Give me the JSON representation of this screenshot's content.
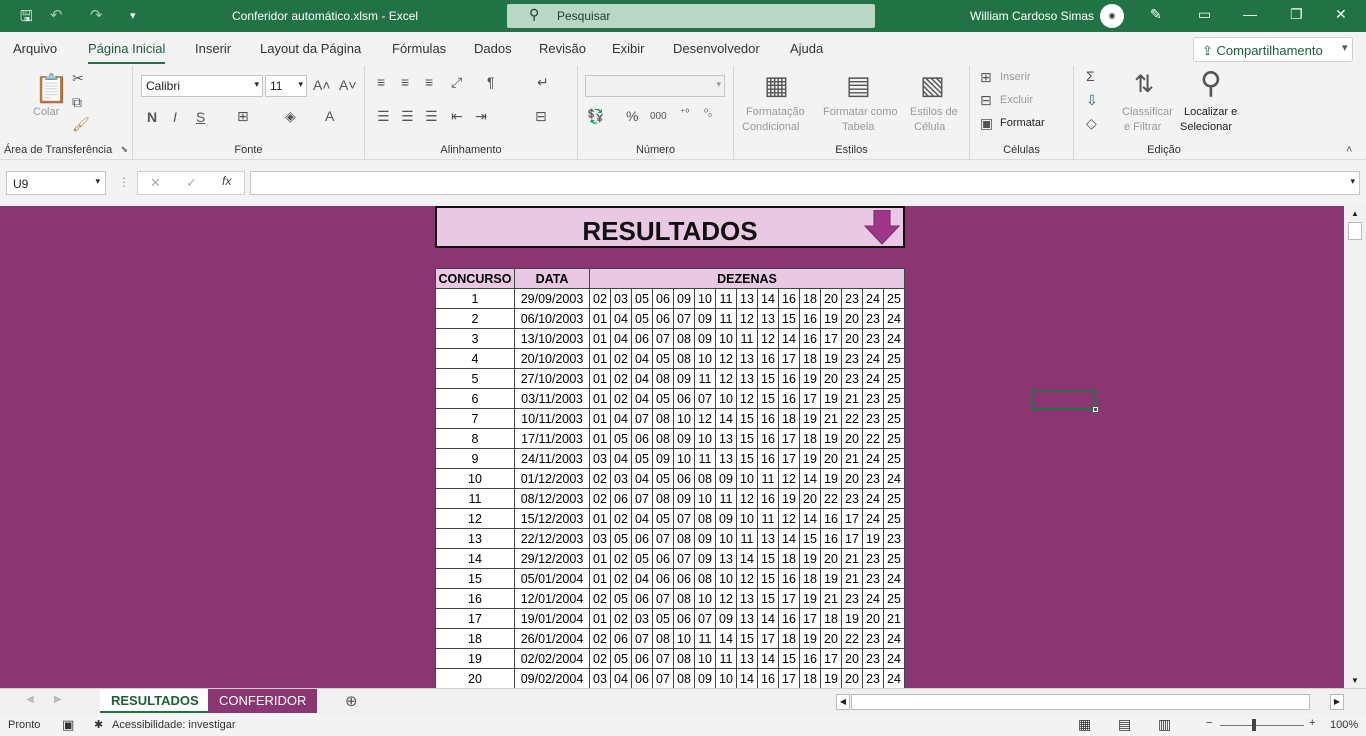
{
  "titlebar": {
    "file_title": "Conferidor automático.xlsm",
    "app_name": "Excel",
    "search_placeholder": "Pesquisar",
    "user_name": "William Cardoso Simas"
  },
  "menu": {
    "tabs": [
      "Arquivo",
      "Página Inicial",
      "Inserir",
      "Layout da Página",
      "Fórmulas",
      "Dados",
      "Revisão",
      "Exibir",
      "Desenvolvedor",
      "Ajuda"
    ],
    "active_tab": "Página Inicial",
    "share_label": "Compartilhamento"
  },
  "ribbon": {
    "clipboard": {
      "paste_label": "Colar",
      "group_label": "Área de Transferência"
    },
    "font": {
      "font_name": "Calibri",
      "font_size": "11",
      "bold": "N",
      "italic": "I",
      "underline": "S",
      "group_label": "Fonte"
    },
    "alignment": {
      "group_label": "Alinhamento"
    },
    "number": {
      "group_label": "Número"
    },
    "styles": {
      "cond_format_1": "Formatação",
      "cond_format_2": "Condicional",
      "format_table_1": "Formatar como",
      "format_table_2": "Tabela",
      "cell_styles_1": "Estilos de",
      "cell_styles_2": "Célula",
      "group_label": "Estilos"
    },
    "cells": {
      "insert": "Inserir",
      "delete": "Excluir",
      "format": "Formatar",
      "group_label": "Células"
    },
    "editing": {
      "sort_1": "Classificar",
      "sort_2": "e Filtrar",
      "find_1": "Localizar e",
      "find_2": "Selecionar",
      "group_label": "Edição"
    }
  },
  "formula_bar": {
    "name_box": "U9",
    "fx": "fx",
    "formula": ""
  },
  "sheet": {
    "banner_title": "RESULTADOS",
    "headers": {
      "concurso": "CONCURSO",
      "data": "DATA",
      "dezenas": "DEZENAS"
    },
    "rows": [
      {
        "concurso": "1",
        "data": "29/09/2003",
        "dezenas": [
          "02",
          "03",
          "05",
          "06",
          "09",
          "10",
          "11",
          "13",
          "14",
          "16",
          "18",
          "20",
          "23",
          "24",
          "25"
        ]
      },
      {
        "concurso": "2",
        "data": "06/10/2003",
        "dezenas": [
          "01",
          "04",
          "05",
          "06",
          "07",
          "09",
          "11",
          "12",
          "13",
          "15",
          "16",
          "19",
          "20",
          "23",
          "24"
        ]
      },
      {
        "concurso": "3",
        "data": "13/10/2003",
        "dezenas": [
          "01",
          "04",
          "06",
          "07",
          "08",
          "09",
          "10",
          "11",
          "12",
          "14",
          "16",
          "17",
          "20",
          "23",
          "24"
        ]
      },
      {
        "concurso": "4",
        "data": "20/10/2003",
        "dezenas": [
          "01",
          "02",
          "04",
          "05",
          "08",
          "10",
          "12",
          "13",
          "16",
          "17",
          "18",
          "19",
          "23",
          "24",
          "25"
        ]
      },
      {
        "concurso": "5",
        "data": "27/10/2003",
        "dezenas": [
          "01",
          "02",
          "04",
          "08",
          "09",
          "11",
          "12",
          "13",
          "15",
          "16",
          "19",
          "20",
          "23",
          "24",
          "25"
        ]
      },
      {
        "concurso": "6",
        "data": "03/11/2003",
        "dezenas": [
          "01",
          "02",
          "04",
          "05",
          "06",
          "07",
          "10",
          "12",
          "15",
          "16",
          "17",
          "19",
          "21",
          "23",
          "25"
        ]
      },
      {
        "concurso": "7",
        "data": "10/11/2003",
        "dezenas": [
          "01",
          "04",
          "07",
          "08",
          "10",
          "12",
          "14",
          "15",
          "16",
          "18",
          "19",
          "21",
          "22",
          "23",
          "25"
        ]
      },
      {
        "concurso": "8",
        "data": "17/11/2003",
        "dezenas": [
          "01",
          "05",
          "06",
          "08",
          "09",
          "10",
          "13",
          "15",
          "16",
          "17",
          "18",
          "19",
          "20",
          "22",
          "25"
        ]
      },
      {
        "concurso": "9",
        "data": "24/11/2003",
        "dezenas": [
          "03",
          "04",
          "05",
          "09",
          "10",
          "11",
          "13",
          "15",
          "16",
          "17",
          "19",
          "20",
          "21",
          "24",
          "25"
        ]
      },
      {
        "concurso": "10",
        "data": "01/12/2003",
        "dezenas": [
          "02",
          "03",
          "04",
          "05",
          "06",
          "08",
          "09",
          "10",
          "11",
          "12",
          "14",
          "19",
          "20",
          "23",
          "24"
        ]
      },
      {
        "concurso": "11",
        "data": "08/12/2003",
        "dezenas": [
          "02",
          "06",
          "07",
          "08",
          "09",
          "10",
          "11",
          "12",
          "16",
          "19",
          "20",
          "22",
          "23",
          "24",
          "25"
        ]
      },
      {
        "concurso": "12",
        "data": "15/12/2003",
        "dezenas": [
          "01",
          "02",
          "04",
          "05",
          "07",
          "08",
          "09",
          "10",
          "11",
          "12",
          "14",
          "16",
          "17",
          "24",
          "25"
        ]
      },
      {
        "concurso": "13",
        "data": "22/12/2003",
        "dezenas": [
          "03",
          "05",
          "06",
          "07",
          "08",
          "09",
          "10",
          "11",
          "13",
          "14",
          "15",
          "16",
          "17",
          "19",
          "23"
        ]
      },
      {
        "concurso": "14",
        "data": "29/12/2003",
        "dezenas": [
          "01",
          "02",
          "05",
          "06",
          "07",
          "09",
          "13",
          "14",
          "15",
          "18",
          "19",
          "20",
          "21",
          "23",
          "25"
        ]
      },
      {
        "concurso": "15",
        "data": "05/01/2004",
        "dezenas": [
          "01",
          "02",
          "04",
          "06",
          "06",
          "08",
          "10",
          "12",
          "15",
          "16",
          "18",
          "19",
          "21",
          "23",
          "24"
        ]
      },
      {
        "concurso": "16",
        "data": "12/01/2004",
        "dezenas": [
          "02",
          "05",
          "06",
          "07",
          "08",
          "10",
          "12",
          "13",
          "15",
          "17",
          "19",
          "21",
          "23",
          "24",
          "25"
        ]
      },
      {
        "concurso": "17",
        "data": "19/01/2004",
        "dezenas": [
          "01",
          "02",
          "03",
          "05",
          "06",
          "07",
          "09",
          "13",
          "14",
          "16",
          "17",
          "18",
          "19",
          "20",
          "21"
        ]
      },
      {
        "concurso": "18",
        "data": "26/01/2004",
        "dezenas": [
          "02",
          "06",
          "07",
          "08",
          "10",
          "11",
          "14",
          "15",
          "17",
          "18",
          "19",
          "20",
          "22",
          "23",
          "24"
        ]
      },
      {
        "concurso": "19",
        "data": "02/02/2004",
        "dezenas": [
          "02",
          "05",
          "06",
          "07",
          "08",
          "10",
          "11",
          "13",
          "14",
          "15",
          "16",
          "17",
          "20",
          "23",
          "24"
        ]
      },
      {
        "concurso": "20",
        "data": "09/02/2004",
        "dezenas": [
          "03",
          "04",
          "06",
          "07",
          "08",
          "09",
          "10",
          "14",
          "16",
          "17",
          "18",
          "19",
          "20",
          "23",
          "24"
        ]
      }
    ]
  },
  "sheet_tabs": {
    "tab1": "RESULTADOS",
    "tab2": "CONFERIDOR"
  },
  "status": {
    "ready": "Pronto",
    "accessibility": "Acessibilidade: investigar",
    "zoom": "100%"
  },
  "colors": {
    "excel_green": "#217346",
    "sheet_bg": "#8b3572",
    "header_fill": "#e8c8e2"
  }
}
